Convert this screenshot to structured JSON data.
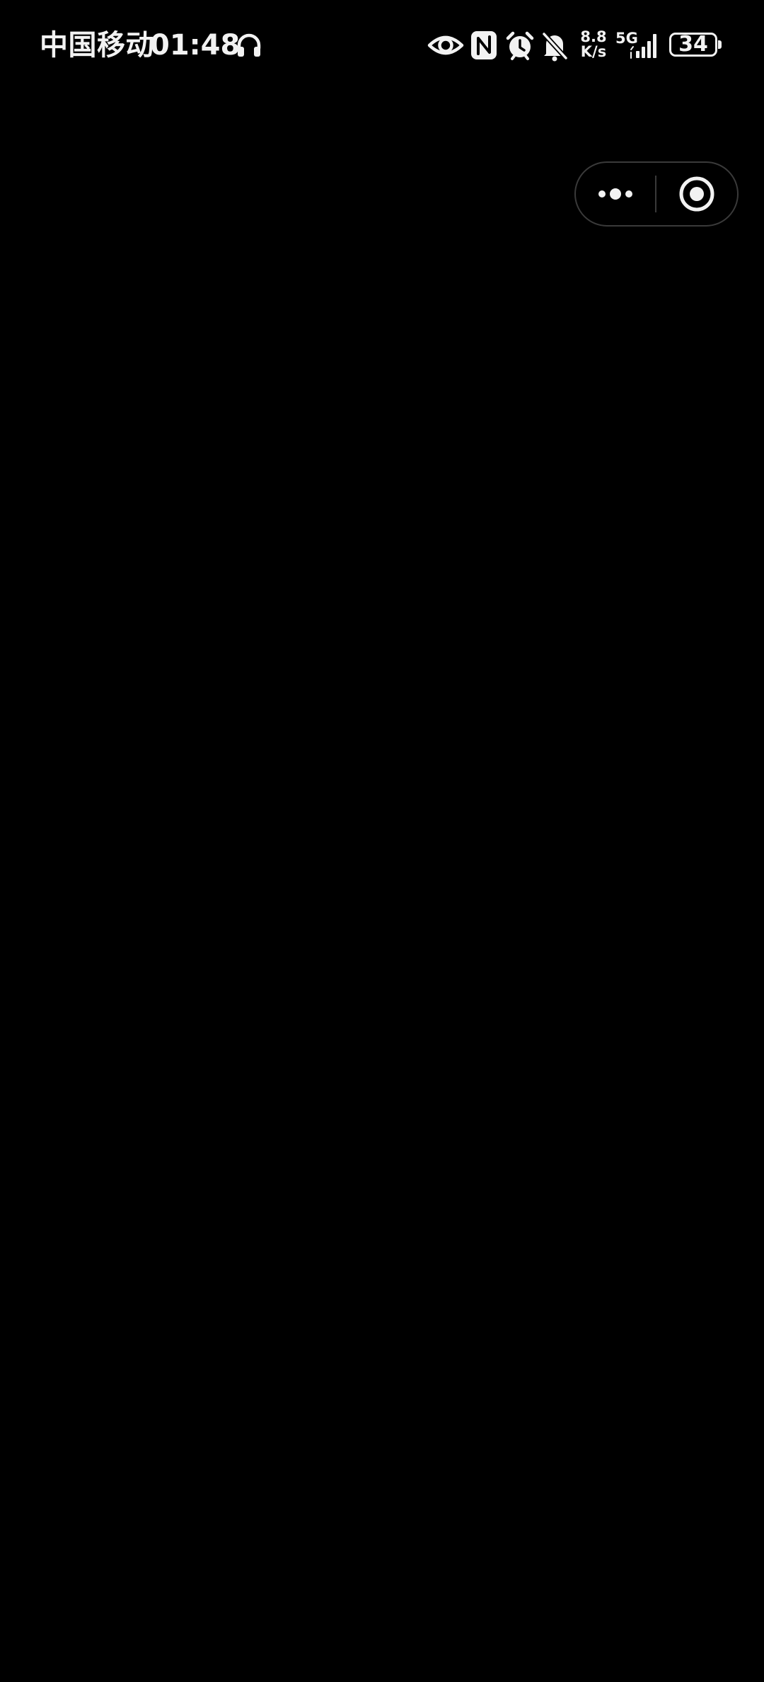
{
  "status_bar": {
    "carrier": "中国移动",
    "time": "01:48",
    "net_speed_value": "8.8",
    "net_speed_unit": "K/s",
    "network_type": "5G",
    "battery_level": "34",
    "icons": [
      "headset-icon",
      "eye-icon",
      "nfc-icon",
      "alarm-icon",
      "bell-off-icon",
      "signal-icon",
      "battery-icon"
    ]
  },
  "capsule": {
    "more_icon": "more-dots-icon",
    "close_icon": "target-close-icon"
  },
  "colors": {
    "background": "#000000",
    "foreground": "#f2f2f2",
    "capsule_border": "#3a3a3a"
  }
}
